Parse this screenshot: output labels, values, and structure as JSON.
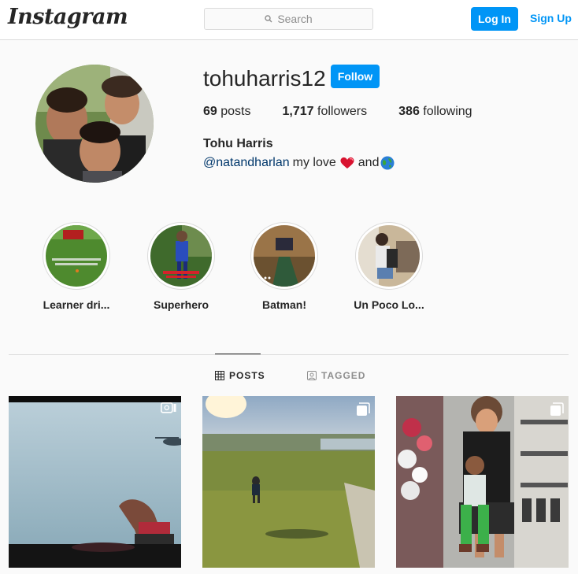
{
  "header": {
    "logo": "Instagram",
    "search_placeholder": "Search",
    "login_label": "Log In",
    "signup_label": "Sign Up"
  },
  "profile": {
    "username": "tohuharris12",
    "follow_label": "Follow",
    "stats": {
      "posts_count": "69",
      "posts_label": "posts",
      "followers_count": "1,717",
      "followers_label": "followers",
      "following_count": "386",
      "following_label": "following"
    },
    "full_name": "Tohu Harris",
    "bio": {
      "mention": "@natandharlan",
      "text1": "my love",
      "heart_emoji": "heart-emoji",
      "text2": "and",
      "globe_emoji": "globe-emoji"
    }
  },
  "highlights": [
    {
      "label": "Learner dri..."
    },
    {
      "label": "Superhero"
    },
    {
      "label": "Batman!"
    },
    {
      "label": "Un Poco Lo..."
    }
  ],
  "tabs": {
    "posts": "POSTS",
    "tagged": "TAGGED"
  },
  "posts": [
    {
      "type_icon": "video-icon"
    },
    {
      "type_icon": "multiple-photos-icon"
    },
    {
      "type_icon": "multiple-photos-icon"
    }
  ],
  "colors": {
    "accent": "#0095f6",
    "mention": "#00376b"
  }
}
